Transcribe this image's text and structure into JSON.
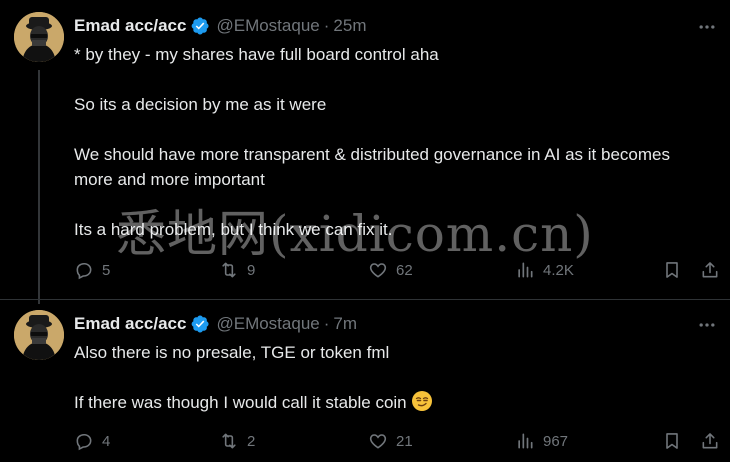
{
  "tweets": [
    {
      "author_name": "Emad acc/acc",
      "handle": "@EMostaque",
      "separator": "·",
      "time": "25m",
      "paragraphs": [
        "* by they - my shares have full board control aha",
        "So its a decision by me as it were",
        "We should have more transparent & distributed governance in AI as it becomes more and more important",
        "Its a hard problem, but I think we can fix it."
      ],
      "replies": "5",
      "reposts": "9",
      "likes": "62",
      "views": "4.2K"
    },
    {
      "author_name": "Emad acc/acc",
      "handle": "@EMostaque",
      "separator": "·",
      "time": "7m",
      "paragraphs": [
        "Also there is no presale, TGE or token fml",
        "If there was though I would call it stable coin"
      ],
      "replies": "4",
      "reposts": "2",
      "likes": "21",
      "views": "967"
    }
  ],
  "watermark": "悉地网(xidicom.cn)",
  "colors": {
    "background": "#000000",
    "text": "#e7e9ea",
    "muted": "#71767b",
    "verified": "#1d9bf0",
    "divider": "#2f3336"
  },
  "icons": [
    "avatar",
    "verified-badge-icon",
    "more-icon",
    "reply-icon",
    "repost-icon",
    "like-icon",
    "views-icon",
    "bookmark-icon",
    "share-icon",
    "smirk-emoji-icon"
  ]
}
